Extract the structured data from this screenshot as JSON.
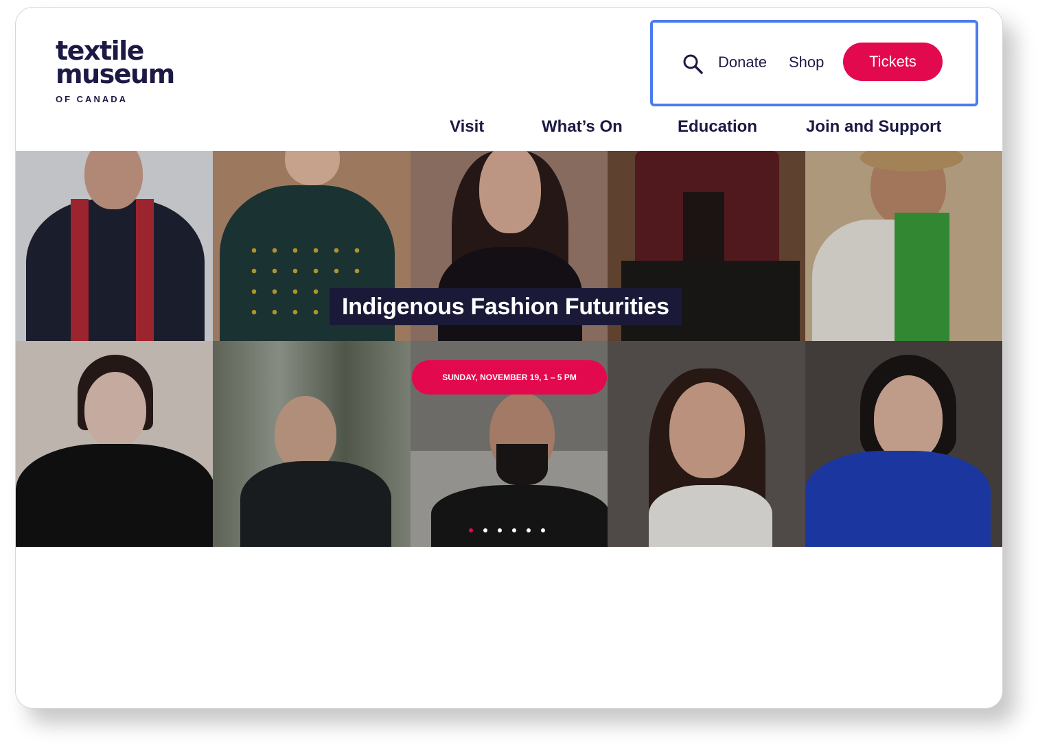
{
  "logo": {
    "line1": "textile",
    "line2": "museum",
    "line3": "OF CANADA"
  },
  "utility": {
    "donate": "Donate",
    "shop": "Shop",
    "tickets": "Tickets",
    "search_icon": "search-icon"
  },
  "nav": {
    "visit": "Visit",
    "whats_on": "What’s On",
    "education": "Education",
    "join": "Join and Support"
  },
  "hero": {
    "title": "Indigenous Fashion Futurities",
    "date": "SUNDAY, NOVEMBER 19, 1 – 5 PM",
    "slides_total": 6,
    "active_slide": 1
  },
  "colors": {
    "brand": "#1c1a45",
    "accent": "#e3094f",
    "highlight": "#4c7bef"
  }
}
